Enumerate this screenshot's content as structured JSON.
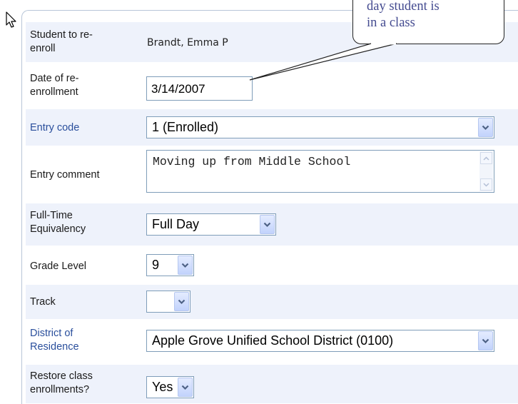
{
  "callout": {
    "line1": "day student is",
    "line2": "in a class"
  },
  "form": {
    "student": {
      "label_line1": "Student to re-",
      "label_line2": "enroll",
      "value": "Brandt, Emma P"
    },
    "date": {
      "label_line1": "Date of re-",
      "label_line2": "enrollment",
      "value": "3/14/2007"
    },
    "entry_code": {
      "label": "Entry code",
      "value": "1 (Enrolled)"
    },
    "entry_comment": {
      "label": "Entry comment",
      "value": "Moving up from Middle School"
    },
    "fte": {
      "label_line1": "Full-Time",
      "label_line2": "Equivalency",
      "value": "Full Day"
    },
    "grade": {
      "label": "Grade Level",
      "value": "9"
    },
    "track": {
      "label": "Track",
      "value": ""
    },
    "district": {
      "label_line1": "District of",
      "label_line2": "Residence",
      "value": "Apple Grove Unified School District (0100)"
    },
    "restore": {
      "label_line1": "Restore class",
      "label_line2": "enrollments?",
      "value": "Yes"
    }
  },
  "colors": {
    "link_label": "#2a4f9c",
    "row_shade": "#eef2fb",
    "callout_text": "#444b90"
  }
}
